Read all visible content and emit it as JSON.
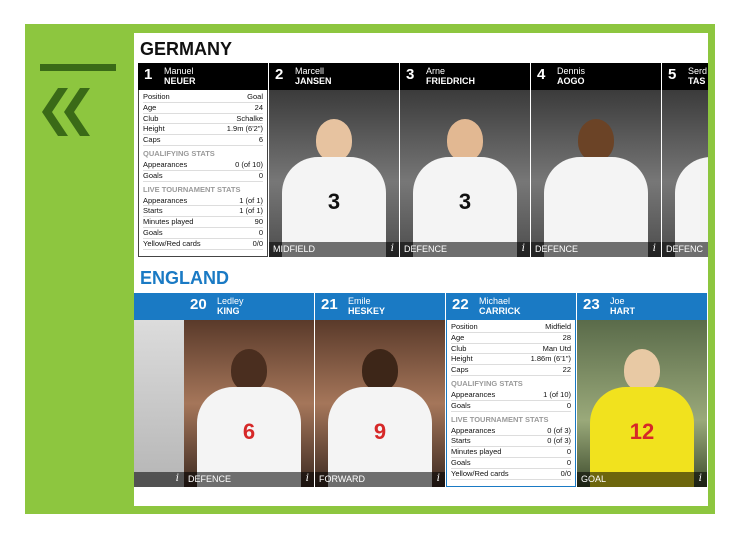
{
  "colors": {
    "frame": "#8dc63f",
    "accent_dark": "#3a6a17",
    "germany_header": "#000000",
    "england_header": "#1a7ac4"
  },
  "nav": {
    "back_icon": "double-chevron-left-icon"
  },
  "germany": {
    "title": "GERMANY",
    "stats_card": {
      "number": "1",
      "first": "Manuel",
      "last": "NEUER",
      "rows1": [
        {
          "k": "Position",
          "v": "Goal"
        },
        {
          "k": "Age",
          "v": "24"
        },
        {
          "k": "Club",
          "v": "Schalke"
        },
        {
          "k": "Height",
          "v": "1.9m (6'2\")"
        },
        {
          "k": "Caps",
          "v": "6"
        }
      ],
      "sec1": "QUALIFYING STATS",
      "rows2": [
        {
          "k": "Appearances",
          "v": "0 (of 10)"
        },
        {
          "k": "Goals",
          "v": "0"
        }
      ],
      "sec2": "LIVE TOURNAMENT STATS",
      "rows3": [
        {
          "k": "Appearances",
          "v": "1 (of 1)"
        },
        {
          "k": "Starts",
          "v": "1 (of 1)"
        },
        {
          "k": "Minutes played",
          "v": "90"
        },
        {
          "k": "Goals",
          "v": "0"
        },
        {
          "k": "Yellow/Red cards",
          "v": "0/0"
        }
      ]
    },
    "players": [
      {
        "number": "2",
        "first": "Marcell",
        "last": "JANSEN",
        "position": "MIDFIELD",
        "kit": "3"
      },
      {
        "number": "3",
        "first": "Arne",
        "last": "FRIEDRICH",
        "position": "DEFENCE",
        "kit": "3"
      },
      {
        "number": "4",
        "first": "Dennis",
        "last": "AOGO",
        "position": "DEFENCE",
        "kit": ""
      },
      {
        "number": "5",
        "first": "Serd",
        "last": "TAS",
        "position": "DEFENC",
        "kit": ""
      }
    ]
  },
  "england": {
    "title": "ENGLAND",
    "players": [
      {
        "number": "20",
        "first": "Ledley",
        "last": "KING",
        "position": "DEFENCE",
        "kit": "6"
      },
      {
        "number": "21",
        "first": "Emile",
        "last": "HESKEY",
        "position": "FORWARD",
        "kit": "9"
      }
    ],
    "stats_card": {
      "number": "22",
      "first": "Michael",
      "last": "CARRICK",
      "rows1": [
        {
          "k": "Position",
          "v": "Midfield"
        },
        {
          "k": "Age",
          "v": "28"
        },
        {
          "k": "Club",
          "v": "Man Utd"
        },
        {
          "k": "Height",
          "v": "1.86m (6'1\")"
        },
        {
          "k": "Caps",
          "v": "22"
        }
      ],
      "sec1": "QUALIFYING STATS",
      "rows2": [
        {
          "k": "Appearances",
          "v": "1 (of 10)"
        },
        {
          "k": "Goals",
          "v": "0"
        }
      ],
      "sec2": "LIVE TOURNAMENT STATS",
      "rows3": [
        {
          "k": "Appearances",
          "v": "0 (of 3)"
        },
        {
          "k": "Starts",
          "v": "0 (of 3)"
        },
        {
          "k": "Minutes played",
          "v": "0"
        },
        {
          "k": "Goals",
          "v": "0"
        },
        {
          "k": "Yellow/Red cards",
          "v": "0/0"
        }
      ]
    },
    "last": {
      "number": "23",
      "first": "Joe",
      "last": "HART",
      "position": "GOAL",
      "kit": "12"
    },
    "info_glyph": "i"
  }
}
